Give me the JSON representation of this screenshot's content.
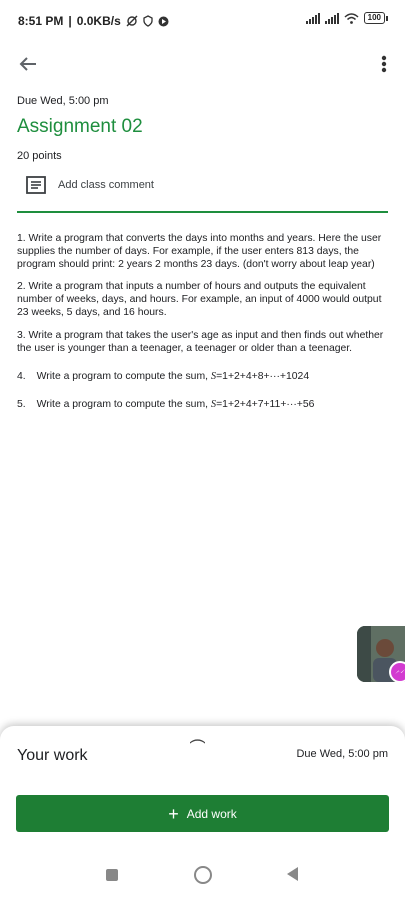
{
  "status": {
    "time": "8:51 PM",
    "speed": "0.0KB/s",
    "battery": "100"
  },
  "assignment": {
    "due": "Due Wed, 5:00 pm",
    "title": "Assignment 02",
    "points": "20 points",
    "comment_label": "Add class comment"
  },
  "questions": {
    "q1": "1. Write a program that converts the days into months and years. Here the user supplies the number of days. For example, if the user enters 813 days, the program should print: 2 years 2 months 23 days. (don't worry about leap year)",
    "q2": "2. Write a program that inputs a number of hours and outputs the equivalent number of weeks, days, and hours. For example, an input of 4000 would output 23 weeks, 5 days, and 16 hours.",
    "q3": "3. Write a program that takes the user's age as input and then finds out whether the user is younger than a teenager, a teenager or older than a teenager.",
    "q4_num": "4.",
    "q4_text": "Write a program to compute the sum,",
    "q4_formula": "S",
    "q4_sum": "=1+2+4+8+···+1024",
    "q5_num": "5.",
    "q5_text": "Write a program to compute the sum,",
    "q5_formula": "S",
    "q5_sum": "=1+2+4+7+11+···+56"
  },
  "bottom": {
    "your_work": "Your work",
    "due": "Due Wed, 5:00 pm",
    "add_work": "Add work"
  },
  "colors": {
    "accent": "#1e8e3e",
    "button": "#1e7e34"
  }
}
